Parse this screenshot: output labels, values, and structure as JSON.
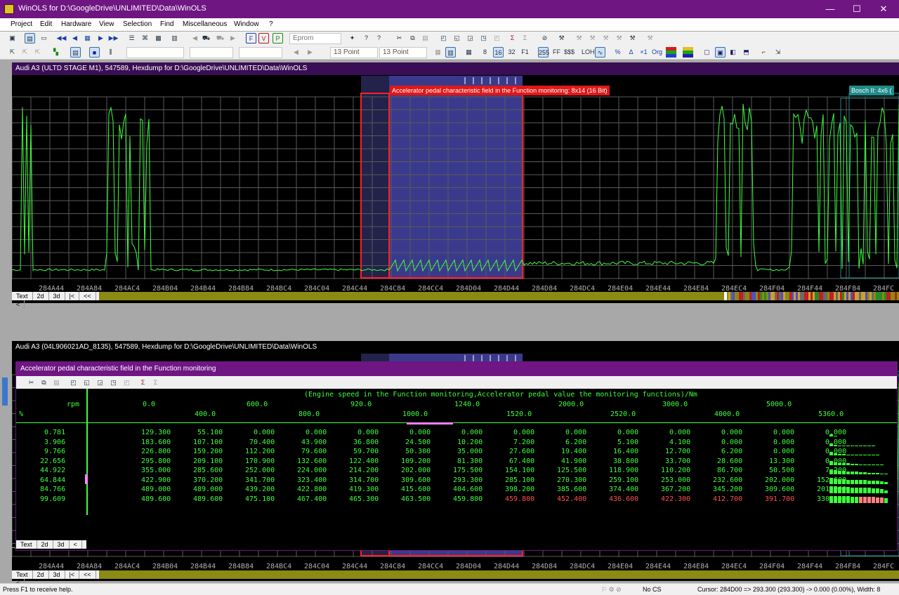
{
  "window": {
    "title": "WinOLS for D:\\GoogleDrive\\UNLIMITED\\Data\\WinOLS",
    "min": "—",
    "max": "☐",
    "close": "✕"
  },
  "menu": [
    "Project",
    "Edit",
    "Hardware",
    "View",
    "Selection",
    "Find",
    "Miscellaneous",
    "Window",
    "?"
  ],
  "toolbar": {
    "eprom_label": "Eprom",
    "font1": "13 Point",
    "font2": "13 Point",
    "btn_8": "8",
    "btn_16": "16",
    "btn_32": "32",
    "btn_f1": "F1",
    "btn_255": "255",
    "btn_ff": "FF",
    "btn_hex": "$$$",
    "btn_lohi": "LOHI",
    "btn_x1": "×1",
    "btn_org": "Org",
    "btn_pct": "%",
    "btn_delta": "Δ"
  },
  "pane1": {
    "title": "Audi A3 (ULTD STAGE M1), 547589, Hexdump for D:\\GoogleDrive\\UNLIMITED\\Data\\WinOLS",
    "map_label": "Accelerator pedal characteristic field in the Function monitoring: 8x14 (16 Bit)",
    "bosch_label": "Bosch II: 4x6 (",
    "addresses": [
      "284A44",
      "284A84",
      "284AC4",
      "284B04",
      "284B44",
      "284B84",
      "284BC4",
      "284C04",
      "284C44",
      "284C84",
      "284CC4",
      "284D04",
      "284D44",
      "284D84",
      "284DC4",
      "284E04",
      "284E44",
      "284E84",
      "284EC4",
      "284F04",
      "284F44",
      "284F84",
      "284FC"
    ],
    "tabs": [
      "Text",
      "2d",
      "3d",
      "|<",
      "<<",
      "<"
    ]
  },
  "pane2": {
    "title": "Audi A3 (04L906021AD_8135), 547589, Hexdump for D:\\GoogleDrive\\UNLIMITED\\Data\\WinOLS",
    "tabs": [
      "Text",
      "2d",
      "3d",
      "|<",
      "<<",
      "<"
    ]
  },
  "map_window": {
    "title": "Accelerator pedal characteristic field in the Function monitoring",
    "tabs": [
      "Text",
      "2d",
      "3d",
      "<"
    ],
    "header_line": "(Engine speed in the Function monitoring,Accelerator pedal value the monitoring functions)/Nm",
    "x_unit": "rpm",
    "y_unit": "%",
    "x_axis": [
      "0.0",
      "400.0",
      "600.0",
      "800.0",
      "920.0",
      "1000.0",
      "1240.0",
      "1520.0",
      "2000.0",
      "2520.0",
      "3000.0",
      "4000.0",
      "5000.0",
      "5360.0"
    ],
    "y_axis": [
      "0.781",
      "3.906",
      "9.766",
      "22.656",
      "44.922",
      "64.844",
      "84.766",
      "99.609"
    ],
    "rows": [
      [
        "129.300",
        "55.100",
        "0.000",
        "0.000",
        "0.000",
        "0.000",
        "0.000",
        "0.000",
        "0.000",
        "0.000",
        "0.000",
        "0.000",
        "0.000",
        "0.000"
      ],
      [
        "183.600",
        "107.100",
        "70.400",
        "43.900",
        "36.800",
        "24.500",
        "10.200",
        "7.200",
        "6.200",
        "5.100",
        "4.100",
        "0.000",
        "0.000",
        "0.000"
      ],
      [
        "226.800",
        "159.200",
        "112.200",
        "79.600",
        "59.700",
        "50.300",
        "35.000",
        "27.600",
        "19.400",
        "16.400",
        "12.700",
        "6.200",
        "0.000",
        "0.000"
      ],
      [
        "295.800",
        "209.100",
        "170.900",
        "132.600",
        "122.400",
        "109.200",
        "81.300",
        "67.400",
        "41.900",
        "38.800",
        "33.700",
        "28.600",
        "13.300",
        "0.000"
      ],
      [
        "355.000",
        "285.600",
        "252.000",
        "224.000",
        "214.200",
        "202.000",
        "175.500",
        "154.100",
        "125.500",
        "118.900",
        "110.200",
        "86.700",
        "50.500",
        "7.200"
      ],
      [
        "422.900",
        "370.200",
        "341.700",
        "323.400",
        "314.700",
        "309.600",
        "293.300",
        "285.100",
        "270.300",
        "259.100",
        "253.000",
        "232.600",
        "202.000",
        "152.600"
      ],
      [
        "489.000",
        "489.000",
        "439.200",
        "422.800",
        "419.300",
        "415.600",
        "404.600",
        "398.200",
        "385.600",
        "374.400",
        "367.200",
        "345.200",
        "309.600",
        "201.000"
      ],
      [
        "489.600",
        "489.600",
        "475.100",
        "467.400",
        "465.300",
        "463.500",
        "459.800",
        "459.800",
        "452.400",
        "436.600",
        "422.300",
        "412.700",
        "391.700",
        "330.500"
      ]
    ],
    "changed_color": "#ff5050"
  },
  "status": {
    "help": "Press F1 to receive help.",
    "cs": "No CS",
    "cursor": "Cursor: 284D00 => 293.300 (293.300) -> 0.000 (0.00%), Width: 8"
  },
  "colors": {
    "accent": "#6f1683",
    "curve": "#3cff3c",
    "grid": "#5a5a5a",
    "selection": "#3a3a8c",
    "map_frame": "#ff2020"
  }
}
